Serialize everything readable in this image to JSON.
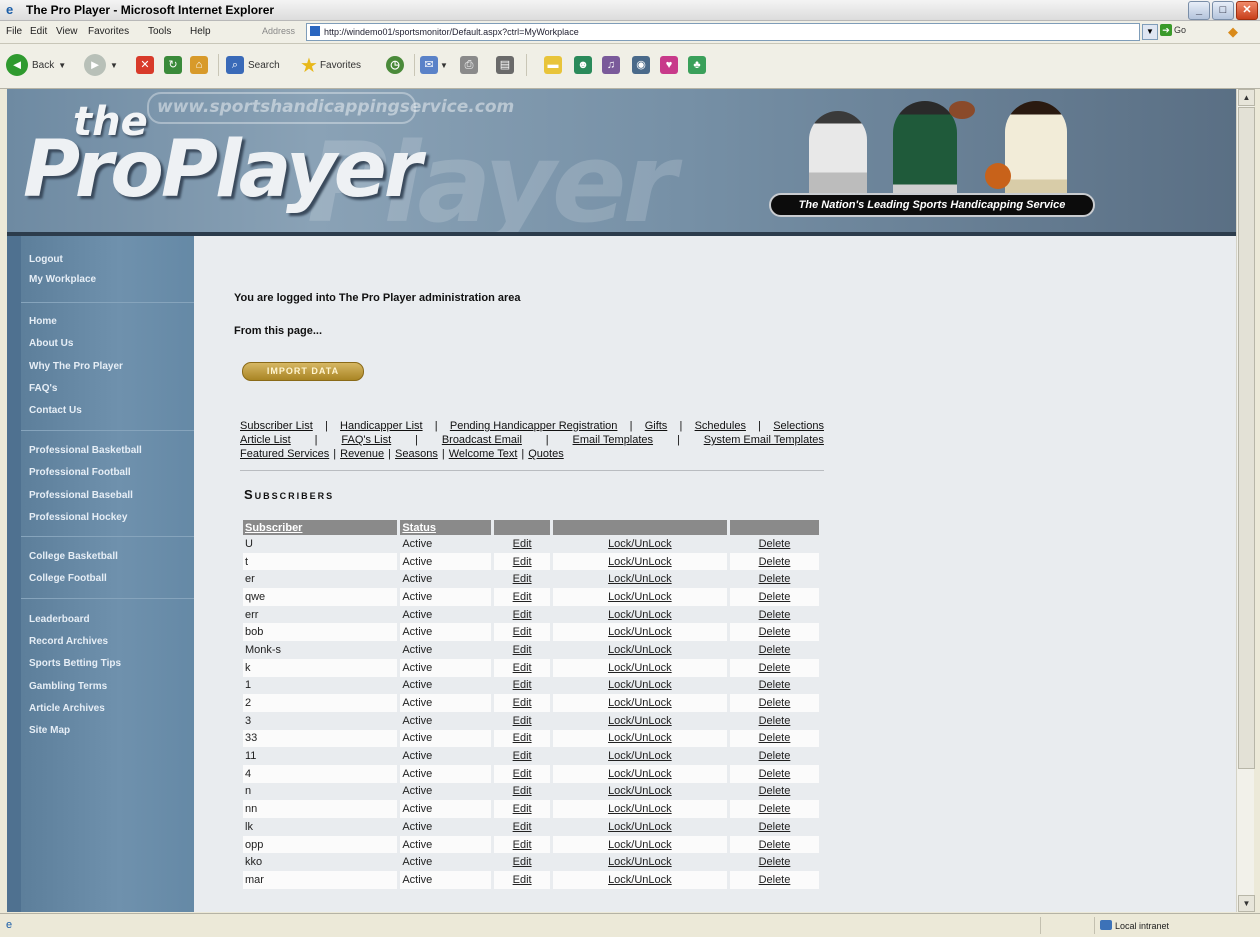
{
  "window": {
    "title": "The Pro Player - Microsoft Internet Explorer",
    "buttons": {
      "minimize": "_",
      "maximize": "□",
      "close": "✕"
    }
  },
  "menu": [
    "File",
    "Edit",
    "View",
    "Favorites",
    "Tools",
    "Help"
  ],
  "address": {
    "label": "Address",
    "url": "http://windemo01/sportsmonitor/Default.aspx?ctrl=MyWorkplace",
    "go": "Go"
  },
  "toolbar": {
    "back": "Back",
    "search": "Search",
    "favorites": "Favorites"
  },
  "banner": {
    "url_text": "www.sportshandicappingservice.com",
    "logo_the": "the",
    "logo": "ProPlayer",
    "tagline": "The Nation's Leading Sports Handicapping Service"
  },
  "sidebar": {
    "groups": [
      [
        "Logout",
        "My Workplace"
      ],
      [
        "Home",
        "About Us",
        "Why The Pro Player",
        "FAQ's",
        "Contact Us"
      ],
      [
        "Professional Basketball",
        "Professional Football",
        "Professional Baseball",
        "Professional Hockey"
      ],
      [
        "College Basketball",
        "College Football"
      ],
      [
        "Leaderboard",
        "Record Archives",
        "Sports Betting Tips",
        "Gambling Terms",
        "Article Archives",
        "Site Map"
      ]
    ]
  },
  "main": {
    "logged_in_text": "You are logged into The Pro Player administration area",
    "from_page_text": "From this page...",
    "import_button": "IMPORT DATA",
    "links_row1": [
      "Subscriber List",
      "Handicapper List",
      "Pending Handicapper Registration",
      "Gifts",
      "Schedules",
      "Selections"
    ],
    "links_row2": [
      "Article List",
      "FAQ's List",
      "Broadcast Email",
      "Email Templates",
      "System Email Templates"
    ],
    "links_row3": [
      "Featured Services",
      "Revenue",
      "Seasons",
      "Welcome Text",
      "Quotes"
    ],
    "section_title": "Subscribers",
    "table": {
      "headers": [
        "Subscriber",
        "Status",
        "",
        "",
        ""
      ],
      "edit_label": "Edit",
      "lock_label": "Lock/UnLock",
      "delete_label": "Delete",
      "rows": [
        {
          "name": "U",
          "status": "Active"
        },
        {
          "name": "t",
          "status": "Active"
        },
        {
          "name": "er",
          "status": "Active"
        },
        {
          "name": "qwe",
          "status": "Active"
        },
        {
          "name": "err",
          "status": "Active"
        },
        {
          "name": "bob",
          "status": "Active"
        },
        {
          "name": "Monk-s",
          "status": "Active"
        },
        {
          "name": "k",
          "status": "Active"
        },
        {
          "name": "1",
          "status": "Active"
        },
        {
          "name": "2",
          "status": "Active"
        },
        {
          "name": "3",
          "status": "Active"
        },
        {
          "name": "33",
          "status": "Active"
        },
        {
          "name": "11",
          "status": "Active"
        },
        {
          "name": "4",
          "status": "Active"
        },
        {
          "name": "n",
          "status": "Active"
        },
        {
          "name": "nn",
          "status": "Active"
        },
        {
          "name": "lk",
          "status": "Active"
        },
        {
          "name": "opp",
          "status": "Active"
        },
        {
          "name": "kko",
          "status": "Active"
        },
        {
          "name": "mar",
          "status": "Active"
        }
      ]
    }
  },
  "status": {
    "zone": "Local intranet"
  }
}
